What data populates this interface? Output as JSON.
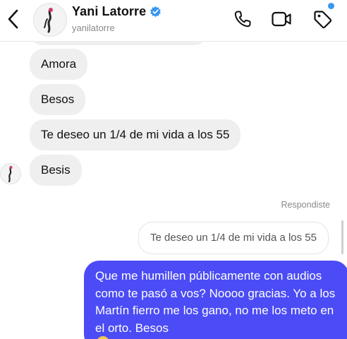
{
  "header": {
    "display_name": "Yani Latorre",
    "username": "yanilatorre",
    "icons": {
      "back": "chevron-left-icon",
      "verified": "verified-badge-icon",
      "call": "phone-icon",
      "video": "video-camera-icon",
      "tag": "tag-icon"
    },
    "accent_color": "#3797f0"
  },
  "messages": {
    "incoming": [
      {
        "text": "Amora"
      },
      {
        "text": "Besos"
      },
      {
        "text": "Te deseo un 1/4 de mi vida a los 55"
      },
      {
        "text": "Besis"
      }
    ],
    "reply": {
      "label": "Respondiste",
      "quoted_text": "Te deseo un 1/4 de mi vida a los 55",
      "text": "Que me humillen públicamente con audios como te pasó a vos? Noooo gracias. Yo a los Martín fierro me los gano, no me los meto en el orto. Besos",
      "bubble_color": "#4b4cf5"
    }
  }
}
